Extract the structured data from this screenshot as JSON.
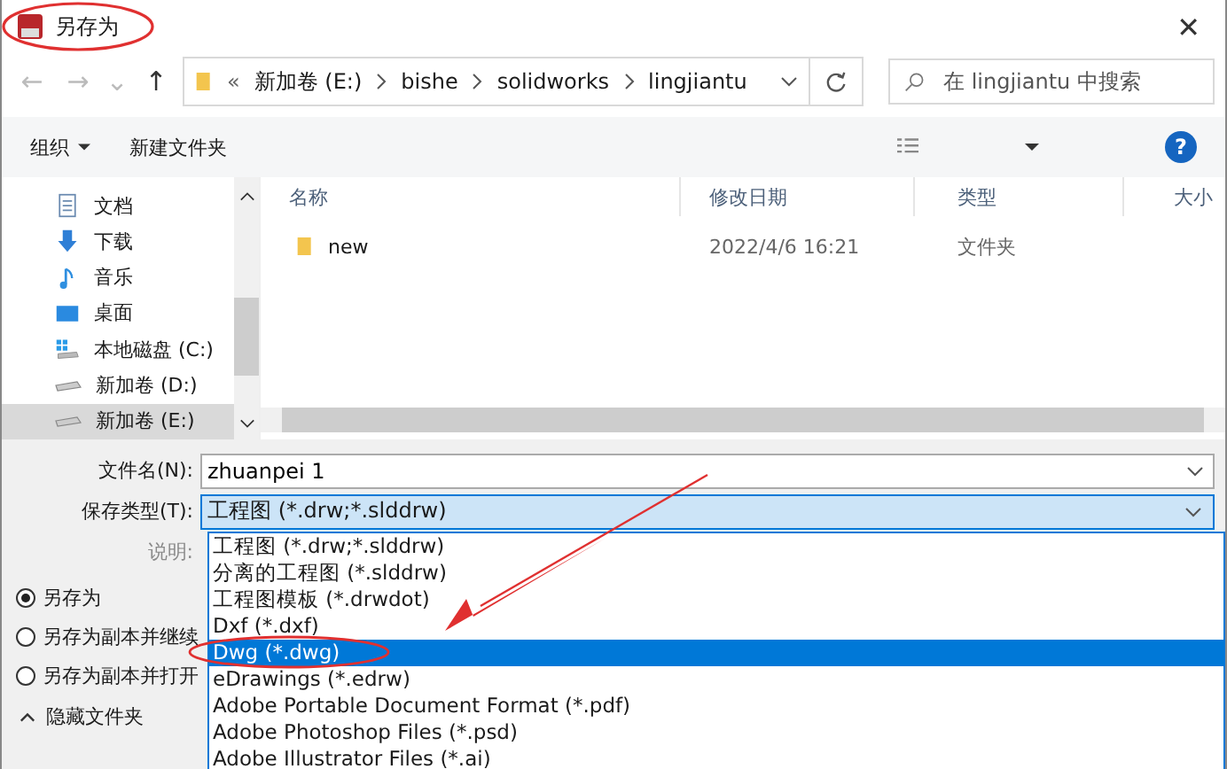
{
  "window": {
    "title": "另存为",
    "close": "✕"
  },
  "nav": {
    "back": "←",
    "forward": "→",
    "recent": "⌄",
    "up": "↑",
    "overflow": "«",
    "path": [
      "新加卷 (E:)",
      "bishe",
      "solidworks",
      "lingjiantu"
    ],
    "search_placeholder": "在 lingjiantu 中搜索"
  },
  "toolbar": {
    "organize": "组织",
    "new_folder": "新建文件夹",
    "help": "?"
  },
  "sidebar": {
    "items": [
      {
        "label": "文档",
        "kind": "document",
        "selected": false
      },
      {
        "label": "下载",
        "kind": "download",
        "selected": false
      },
      {
        "label": "音乐",
        "kind": "music",
        "selected": false
      },
      {
        "label": "桌面",
        "kind": "desktop",
        "selected": false
      },
      {
        "label": "本地磁盘 (C:)",
        "kind": "system-drive",
        "selected": false
      },
      {
        "label": "新加卷 (D:)",
        "kind": "drive",
        "selected": false
      },
      {
        "label": "新加卷 (E:)",
        "kind": "drive",
        "selected": true
      }
    ]
  },
  "table": {
    "columns": [
      "名称",
      "修改日期",
      "类型",
      "大小"
    ],
    "rows": [
      {
        "name": "new",
        "modified": "2022/4/6 16:21",
        "type": "文件夹"
      }
    ]
  },
  "form": {
    "file_name_label": "文件名(N):",
    "file_name": "zhuanpei 1",
    "save_type_label": "保存类型(T):",
    "save_type": "工程图 (*.drw;*.slddrw)",
    "description_label": "说明:"
  },
  "save_type_options": [
    {
      "label": "工程图 (*.drw;*.slddrw)",
      "selected": false
    },
    {
      "label": "分离的工程图 (*.slddrw)",
      "selected": false
    },
    {
      "label": "工程图模板 (*.drwdot)",
      "selected": false
    },
    {
      "label": "Dxf (*.dxf)",
      "selected": false
    },
    {
      "label": "Dwg (*.dwg)",
      "selected": true
    },
    {
      "label": "eDrawings (*.edrw)",
      "selected": false
    },
    {
      "label": "Adobe Portable Document Format (*.pdf)",
      "selected": false
    },
    {
      "label": "Adobe Photoshop Files (*.psd)",
      "selected": false
    },
    {
      "label": "Adobe Illustrator Files (*.ai)",
      "selected": false
    }
  ],
  "save_options": [
    {
      "label": "另存为",
      "selected": true
    },
    {
      "label": "另存为副本并继续",
      "selected": false
    },
    {
      "label": "另存为副本并打开",
      "selected": false
    }
  ],
  "hide_folders": "隐藏文件夹"
}
